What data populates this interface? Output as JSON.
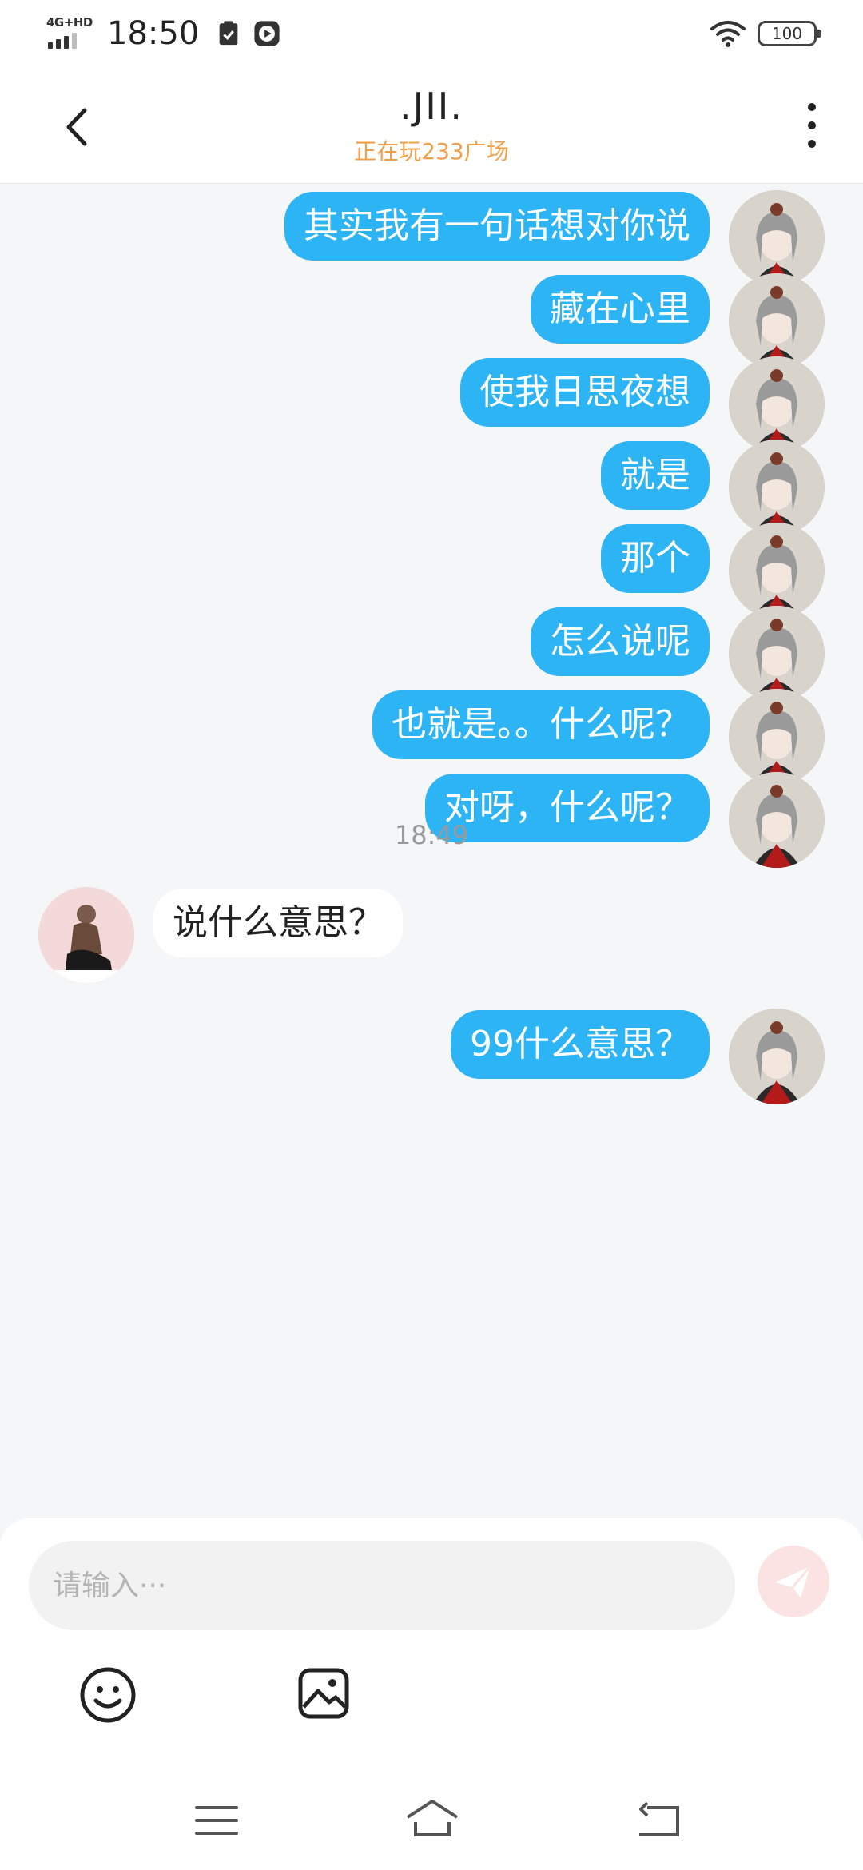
{
  "status_bar": {
    "network": "4G+HD",
    "time": "18:50",
    "battery": "100"
  },
  "header": {
    "title": ".JII.",
    "subtitle": "正在玩233广场"
  },
  "messages": [
    {
      "side": "out",
      "text": "其实我有一句话想对你说"
    },
    {
      "side": "out",
      "text": "藏在心里"
    },
    {
      "side": "out",
      "text": "使我日思夜想"
    },
    {
      "side": "out",
      "text": "就是"
    },
    {
      "side": "out",
      "text": "那个"
    },
    {
      "side": "out",
      "text": "怎么说呢"
    },
    {
      "side": "out",
      "text": "也就是。。什么呢？"
    },
    {
      "side": "out",
      "text": "对呀，什么呢？"
    }
  ],
  "timestamp": "18:49",
  "incoming_message": "说什么意思？",
  "last_message": "99什么意思？",
  "composer": {
    "placeholder": "请输入···"
  },
  "colors": {
    "outgoing_bubble": "#2db4f5",
    "incoming_bubble": "#ffffff",
    "subtitle": "#f0a04b",
    "background": "#f5f6f8"
  },
  "icons": {
    "back": "chevron-left-icon",
    "more": "more-vertical-icon",
    "send": "send-icon",
    "emoji": "smiley-icon",
    "image": "image-icon"
  }
}
